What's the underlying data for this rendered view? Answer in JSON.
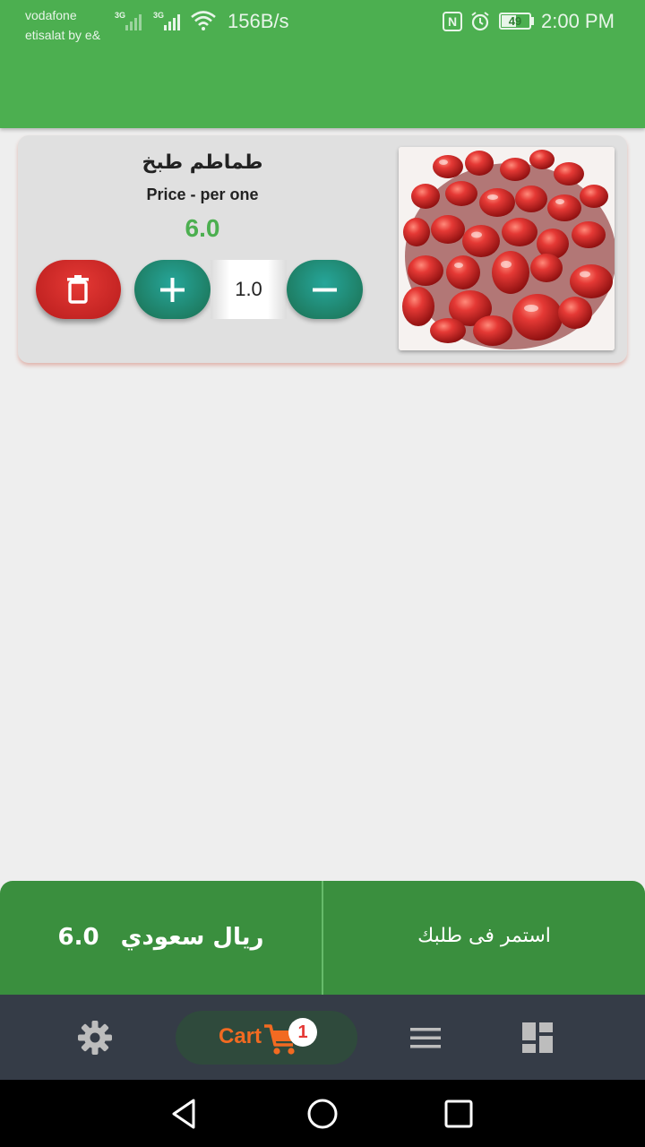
{
  "status_bar": {
    "carrier_1": "vodafone",
    "carrier_2": "etisalat by e&",
    "network_1": "3G",
    "network_2": "3G",
    "speed": "156B/s",
    "nfc": "N",
    "battery": "49",
    "time": "2:00 PM"
  },
  "cart_item": {
    "name": "طماطم طبخ",
    "price_label": "Price - per one",
    "price": "6.0",
    "quantity": "1.0"
  },
  "summary": {
    "total_amount": "6.0",
    "currency": "ريال سعودي",
    "continue_label": "استمر فى طلبك"
  },
  "bottom_nav": {
    "cart_label": "Cart",
    "cart_badge": "1",
    "active_item": "cart"
  },
  "icons": [
    "gear-icon",
    "cart-icon",
    "menu-icon",
    "dashboard-icon",
    "trash-icon",
    "plus-icon",
    "minus-icon",
    "back-icon",
    "home-icon",
    "recents-icon"
  ],
  "colors": {
    "primary_green": "#4caf50",
    "summary_green": "#3a8f3e",
    "price_green": "#4caf50",
    "delete_red": "#d32f2f",
    "stepper_teal": "#1f8a6a",
    "nav_bg": "#353c47",
    "cart_accent": "#f26a21"
  }
}
